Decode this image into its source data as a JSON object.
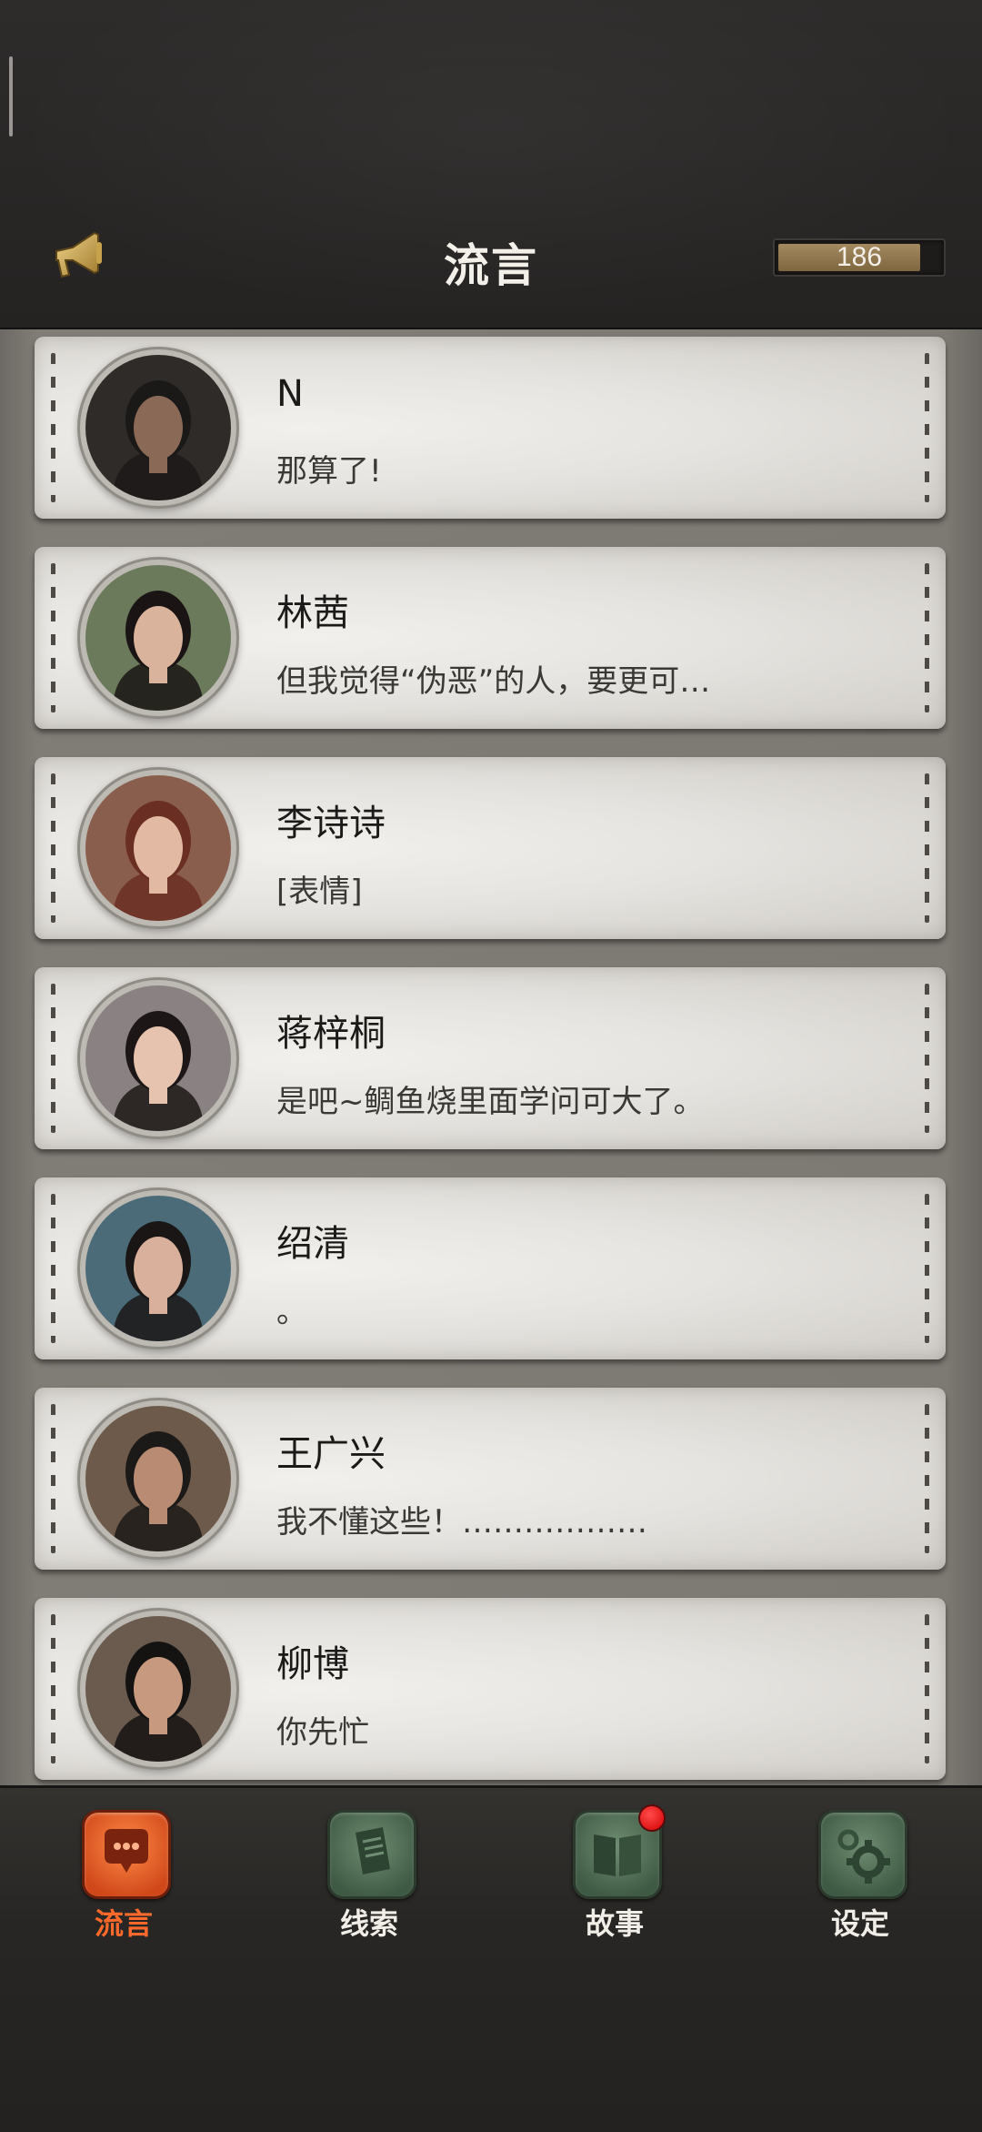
{
  "header": {
    "title": "流言",
    "counter": 186,
    "counter_fill": 0.88,
    "megaphone_icon": "megaphone-icon"
  },
  "contacts": [
    {
      "name": "N",
      "message": "那算了!",
      "avatar_tone": "#2f2b28",
      "hair": "#1b1918",
      "skin": "#8a6a57"
    },
    {
      "name": "林茜",
      "message": "但我觉得“伪恶”的人，要更可…",
      "avatar_tone": "#6b7a5a",
      "hair": "#1a1514",
      "skin": "#d9b39c"
    },
    {
      "name": "李诗诗",
      "message": "[表情]",
      "avatar_tone": "#8a5e4c",
      "hair": "#6a2e22",
      "skin": "#e2b9a2"
    },
    {
      "name": "蒋梓桐",
      "message": "是吧~鲷鱼烧里面学问可大了。",
      "avatar_tone": "#8a8282",
      "hair": "#1c1716",
      "skin": "#e6c3ae"
    },
    {
      "name": "绍清",
      "message": "。",
      "avatar_tone": "#4b6b78",
      "hair": "#1a1616",
      "skin": "#d8b09b"
    },
    {
      "name": "王广兴",
      "message": "我不懂这些！………………",
      "avatar_tone": "#6e5a4a",
      "hair": "#1c1a18",
      "skin": "#b88b72"
    },
    {
      "name": "柳博",
      "message": "你先忙",
      "avatar_tone": "#6a5b4e",
      "hair": "#151312",
      "skin": "#c79a80"
    }
  ],
  "nav": [
    {
      "label": "流言",
      "icon": "chat-bubble-icon",
      "active": true,
      "badge": false
    },
    {
      "label": "线索",
      "icon": "document-icon",
      "active": false,
      "badge": false
    },
    {
      "label": "故事",
      "icon": "book-icon",
      "active": false,
      "badge": true
    },
    {
      "label": "设定",
      "icon": "gear-icon",
      "active": false,
      "badge": false
    }
  ],
  "colors": {
    "accent": "#ff6a2c",
    "badge": "#e00000",
    "header_bg": "#2a2827",
    "card_bg": "#e6e4e0"
  }
}
